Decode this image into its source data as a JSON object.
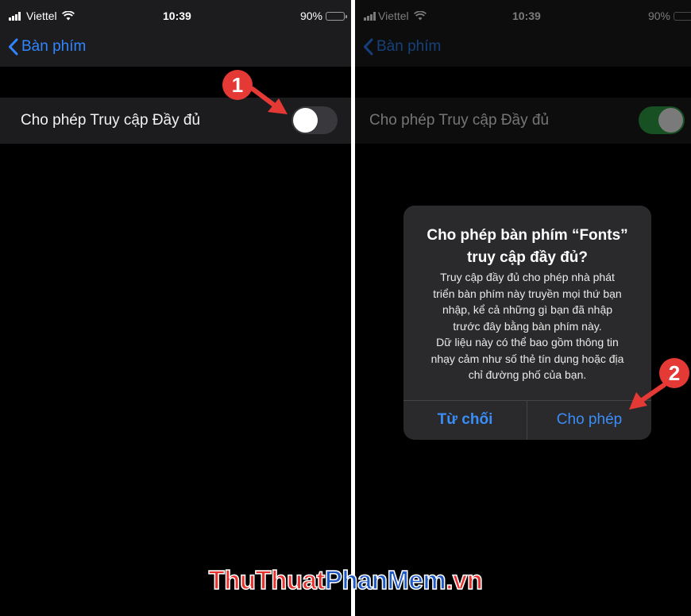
{
  "status_bar": {
    "carrier": "Viettel",
    "time": "10:39",
    "battery": "90%",
    "battery_level": 0.9
  },
  "nav": {
    "back_label": "Bàn phím"
  },
  "setting": {
    "label": "Cho phép Truy cập Đầy đủ",
    "left_state": "off",
    "right_state": "on"
  },
  "dialog": {
    "title": "Cho phép bàn phím “Fonts” truy cập đầy đủ?",
    "message_lines": [
      "Truy cập đầy đủ cho phép nhà phát",
      "triển bàn phím này truyền mọi thứ bạn",
      "nhập, kể cả những gì bạn đã nhập",
      "trước đây bằng bàn phím này.",
      "Dữ liệu này có thể bao gồm thông tin",
      "nhạy cảm như số thẻ tín dụng hoặc địa",
      "chỉ đường phố của bạn."
    ],
    "deny_label": "Từ chối",
    "allow_label": "Cho phép"
  },
  "annotations": {
    "step1": "1",
    "step2": "2",
    "arrow_color": "#e53935"
  },
  "watermark": {
    "part1": "ThuThuat",
    "part2": "PhanMem",
    "part3": ".vn"
  },
  "colors": {
    "accent": "#2f86ff",
    "toggle_on": "#30a74a",
    "toggle_off": "#39393d"
  }
}
